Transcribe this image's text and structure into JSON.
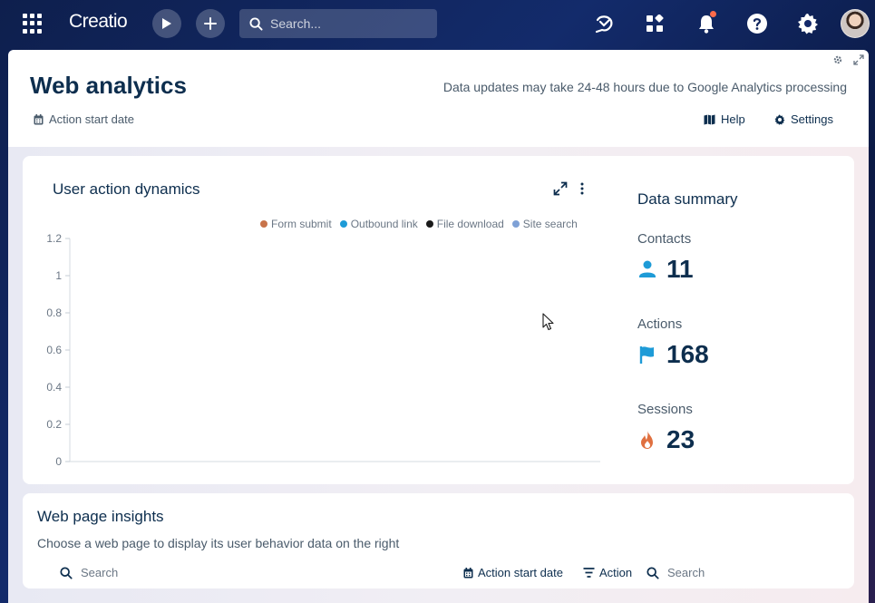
{
  "topbar": {
    "logo_text": "Creatio",
    "search_placeholder": "Search...",
    "notification_dot_color": "#ff6b4a"
  },
  "header": {
    "title": "Web analytics",
    "update_note": "Data updates may take 24-48 hours due to Google Analytics processing",
    "filter_date_label": "Action start date",
    "help_label": "Help",
    "settings_label": "Settings"
  },
  "chart_widget": {
    "title": "User action dynamics"
  },
  "chart_data": {
    "type": "line",
    "title": "User action dynamics",
    "xlabel": "",
    "ylabel": "",
    "ylim": [
      0,
      1.2
    ],
    "yticks": [
      "1.2",
      "1",
      "0.8",
      "0.6",
      "0.4",
      "0.2",
      "0"
    ],
    "legend_position": "top-right",
    "series": [
      {
        "name": "Form submit",
        "color": "#c8734a",
        "values": []
      },
      {
        "name": "Outbound link",
        "color": "#1e9bd7",
        "values": []
      },
      {
        "name": "File download",
        "color": "#1a1a1a",
        "values": []
      },
      {
        "name": "Site search",
        "color": "#7fa1d6",
        "values": []
      }
    ]
  },
  "summary": {
    "title": "Data summary",
    "metrics": [
      {
        "label": "Contacts",
        "value": "11",
        "icon": "person-icon",
        "icon_color": "#1e9bd7"
      },
      {
        "label": "Actions",
        "value": "168",
        "icon": "flag-icon",
        "icon_color": "#1e9bd7"
      },
      {
        "label": "Sessions",
        "value": "23",
        "icon": "flame-icon",
        "icon_color": "#e07040"
      }
    ]
  },
  "insights": {
    "title": "Web page insights",
    "subtitle": "Choose a web page to display its user behavior data on the right",
    "search_placeholder": "Search",
    "date_filter_label": "Action start date",
    "action_filter_label": "Action",
    "search2_placeholder": "Search"
  }
}
